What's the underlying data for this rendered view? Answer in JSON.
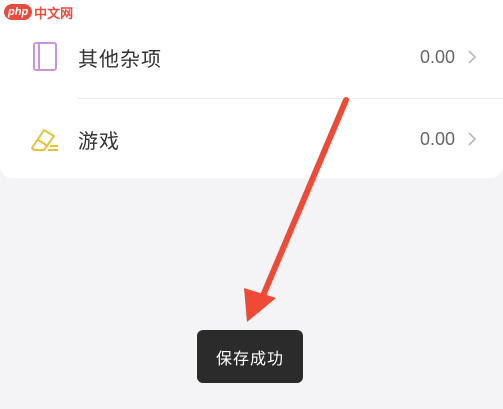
{
  "watermark": {
    "logo": "php",
    "text": "中文网"
  },
  "categories": [
    {
      "label": "其他杂项",
      "amount": "0.00",
      "icon": "notebook-icon",
      "color": "#c896d8"
    },
    {
      "label": "游戏",
      "amount": "0.00",
      "icon": "eraser-icon",
      "color": "#e8c03c"
    }
  ],
  "toast": {
    "message": "保存成功"
  },
  "colors": {
    "arrow": "#ef4a36",
    "toast_bg": "#2b2b2b",
    "background": "#f4f4f6"
  }
}
